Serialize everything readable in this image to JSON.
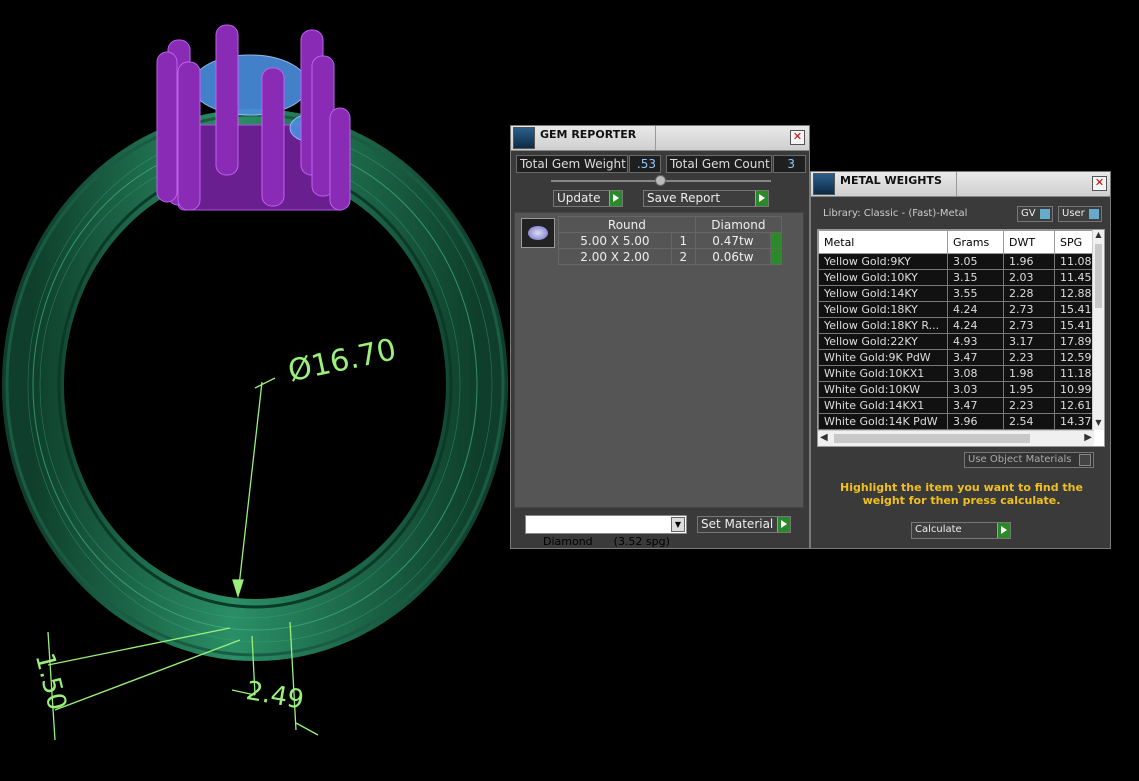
{
  "dimensions": {
    "diameter": "Ø16.70",
    "thickness": "1.50",
    "width": "2.49"
  },
  "gem_reporter": {
    "title": "GEM REPORTER",
    "total_weight_label": "Total Gem Weight",
    "total_weight_value": ".53",
    "total_count_label": "Total Gem Count",
    "total_count_value": "3",
    "update_label": "Update",
    "save_label": "Save Report",
    "group": {
      "shape": "Round",
      "material": "Diamond",
      "rows": [
        {
          "size": "5.00 X 5.00",
          "count": "1",
          "weight": "0.47tw"
        },
        {
          "size": "2.00 X 2.00",
          "count": "2",
          "weight": "0.06tw"
        }
      ]
    },
    "material_select": "Diamond      (3.52 spg)",
    "set_material_label": "Set Material"
  },
  "metal_weights": {
    "title": "METAL WEIGHTS",
    "library": "Library: Classic - (Fast)-Metal",
    "gv_label": "GV",
    "user_label": "User",
    "columns": [
      "Metal",
      "Grams",
      "DWT",
      "SPG"
    ],
    "rows": [
      [
        "Yellow Gold:9KY",
        "3.05",
        "1.96",
        "11.08"
      ],
      [
        "Yellow Gold:10KY",
        "3.15",
        "2.03",
        "11.45"
      ],
      [
        "Yellow Gold:14KY",
        "3.55",
        "2.28",
        "12.88"
      ],
      [
        "Yellow Gold:18KY",
        "4.24",
        "2.73",
        "15.41"
      ],
      [
        "Yellow Gold:18KY R...",
        "4.24",
        "2.73",
        "15.41"
      ],
      [
        "Yellow Gold:22KY",
        "4.93",
        "3.17",
        "17.89"
      ],
      [
        "White Gold:9K PdW",
        "3.47",
        "2.23",
        "12.59"
      ],
      [
        "White Gold:10KX1",
        "3.08",
        "1.98",
        "11.18"
      ],
      [
        "White Gold:10KW",
        "3.03",
        "1.95",
        "10.99"
      ],
      [
        "White Gold:14KX1",
        "3.47",
        "2.23",
        "12.61"
      ],
      [
        "White Gold:14K PdW",
        "3.96",
        "2.54",
        "14.37"
      ]
    ],
    "use_object_materials": "Use Object Materials",
    "instruction": "Highlight the item you want to find the weight for then press calculate.",
    "calculate_label": "Calculate"
  },
  "colors": {
    "ring_band": "#1f6e4f",
    "ring_highlight": "#3fb585",
    "prongs": "#8a2bb5",
    "gem": "#4a8fe0",
    "dimension_lines": "#9af07a",
    "instruction_text": "#f0c020",
    "go_button": "#2a8a2a"
  }
}
